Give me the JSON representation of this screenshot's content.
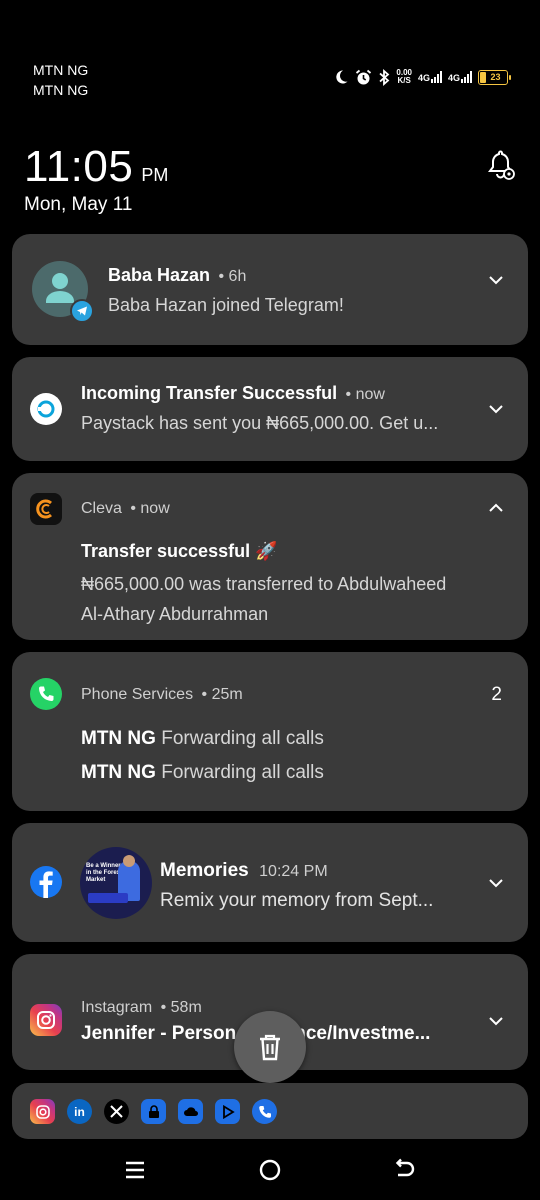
{
  "status_bar": {
    "carrier_1": "MTN NG",
    "carrier_2": "MTN NG",
    "net_speed_value": "0.00",
    "net_speed_unit": "K/S",
    "sim1_network": "4G",
    "sim2_network": "4G",
    "battery_level": "23",
    "battery_color": "#f5c542"
  },
  "lockscreen": {
    "time": "11:05",
    "ampm": "PM",
    "date": "Mon, May 11"
  },
  "notifications": [
    {
      "app_icon": "telegram-contact-avatar",
      "title": "Baba Hazan",
      "meta": "• 6h",
      "body": "Baba Hazan joined Telegram!"
    },
    {
      "app_icon": "paystack-icon",
      "title": "Incoming Transfer Successful",
      "meta": "• now",
      "body": "Paystack has sent you ₦665,000.00. Get u..."
    },
    {
      "app_icon": "cleva-icon",
      "app_name": "Cleva",
      "meta": "• now",
      "title": "Transfer successful 🚀",
      "body_line_1": "₦665,000.00 was transferred to Abdulwaheed",
      "body_line_2": "Al-Athary Abdurrahman"
    },
    {
      "app_icon": "phone-icon",
      "app_name": "Phone Services",
      "meta": "• 25m",
      "count": "2",
      "lines": [
        {
          "sender": "MTN NG",
          "text": "Forwarding all calls"
        },
        {
          "sender": "MTN NG",
          "text": "Forwarding all calls"
        }
      ]
    },
    {
      "app_icon": "facebook-icon",
      "title": "Memories",
      "meta": "10:24 PM",
      "body": "Remix your memory from Sept...",
      "thumbnail_text_1": "Be a Winner",
      "thumbnail_text_2": "in the Forex",
      "thumbnail_text_3": "Market"
    },
    {
      "app_icon": "instagram-icon",
      "app_name": "Instagram",
      "meta": "• 58m",
      "body_start": "Jennifer - Person",
      "body_end": "nce/Investme..."
    }
  ],
  "overflow_apps": [
    "instagram-icon",
    "linkedin-icon",
    "x-icon",
    "lock-app-icon",
    "cloud-app-icon",
    "google-play-icon",
    "phone-call-app-icon"
  ],
  "colors": {
    "card_bg": "#3a3a3a",
    "paystack": "#0ba4db",
    "cleva_accent": "#f7931e",
    "phone": "#25d366",
    "facebook": "#1877f2",
    "telegram": "#2aa3df"
  }
}
